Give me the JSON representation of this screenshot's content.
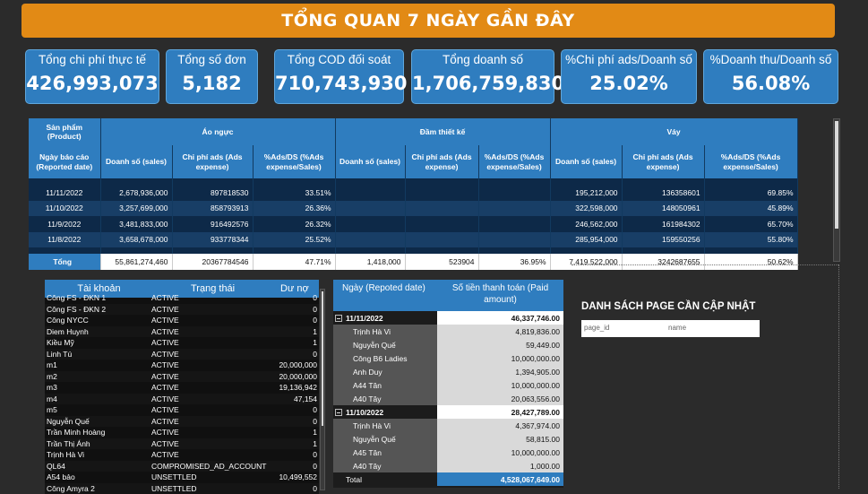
{
  "banner": {
    "title": "TỔNG QUAN 7 NGÀY GẦN ĐÂY"
  },
  "kpis": [
    {
      "label": "Tổng chi phí thực tế",
      "value": "426,993,073"
    },
    {
      "label": "Tổng số đơn",
      "value": "5,182"
    },
    {
      "label": "Tổng COD đối soát",
      "value": "710,743,930"
    },
    {
      "label": "Tổng doanh số",
      "value": "1,706,759,830"
    },
    {
      "label": "%Chi phí ads/Doanh số",
      "value": "25.02%"
    },
    {
      "label": "%Doanh thu/Doanh số",
      "value": "56.08%"
    }
  ],
  "matrix": {
    "product_header": "Sản phẩm (Product)",
    "date_header": "Ngày báo cáo (Reported date)",
    "groups": [
      "Áo ngực",
      "Đầm thiết kế",
      "Váy"
    ],
    "g1_cols": [
      "Doanh số (sales)",
      "Chi phí ads (Ads expense)",
      "%Ads/DS (%Ads expense/Sales)"
    ],
    "g2_cols": [
      "Doanh số (sales)",
      "Chi phí ads (Ads expense)",
      "%Ads/DS (%Ads expense/Sales)"
    ],
    "g3_cols": [
      "Doanh số (sales)",
      "Chi phí ads (Ads expense)",
      "%Ads/DS (%Ads expense/Sales)"
    ],
    "rows": [
      {
        "date": "11/11/2022",
        "g1": [
          "2,678,936,000",
          "897818530",
          "33.51%"
        ],
        "g2": [
          "",
          "",
          ""
        ],
        "g3": [
          "195,212,000",
          "136358601",
          "69.85%"
        ]
      },
      {
        "date": "11/10/2022",
        "g1": [
          "3,257,699,000",
          "858793913",
          "26.36%"
        ],
        "g2": [
          "",
          "",
          ""
        ],
        "g3": [
          "322,598,000",
          "148050961",
          "45.89%"
        ]
      },
      {
        "date": "11/9/2022",
        "g1": [
          "3,481,833,000",
          "916492576",
          "26.32%"
        ],
        "g2": [
          "",
          "",
          ""
        ],
        "g3": [
          "246,562,000",
          "161984302",
          "65.70%"
        ]
      },
      {
        "date": "11/8/2022",
        "g1": [
          "3,658,678,000",
          "933778344",
          "25.52%"
        ],
        "g2": [
          "",
          "",
          ""
        ],
        "g3": [
          "285,954,000",
          "159550256",
          "55.80%"
        ]
      }
    ],
    "total": {
      "label": "Tổng",
      "g1": [
        "55,861,274,460",
        "20367784546",
        "47.71%"
      ],
      "g2": [
        "1,418,000",
        "523904",
        "36.95%"
      ],
      "g3": [
        "7,419,522,000",
        "3242687655",
        "50.62%"
      ]
    }
  },
  "accounts": {
    "headers": {
      "account": "Tài khoản",
      "status": "Trạng thái",
      "debt": "Dư nợ"
    },
    "rows": [
      {
        "account": "Công FS - ĐKN 1",
        "status": "ACTIVE",
        "debt": "0"
      },
      {
        "account": "Công FS - ĐKN 2",
        "status": "ACTIVE",
        "debt": "0"
      },
      {
        "account": "Công NYCC",
        "status": "ACTIVE",
        "debt": "0"
      },
      {
        "account": "Diem Huynh",
        "status": "ACTIVE",
        "debt": "1"
      },
      {
        "account": "Kiều Mỹ",
        "status": "ACTIVE",
        "debt": "1"
      },
      {
        "account": "Linh Tú",
        "status": "ACTIVE",
        "debt": "0"
      },
      {
        "account": "m1",
        "status": "ACTIVE",
        "debt": "20,000,000"
      },
      {
        "account": "m2",
        "status": "ACTIVE",
        "debt": "20,000,000"
      },
      {
        "account": "m3",
        "status": "ACTIVE",
        "debt": "19,136,942"
      },
      {
        "account": "m4",
        "status": "ACTIVE",
        "debt": "47,154"
      },
      {
        "account": "m5",
        "status": "ACTIVE",
        "debt": "0"
      },
      {
        "account": "Nguyễn Quế",
        "status": "ACTIVE",
        "debt": "0"
      },
      {
        "account": "Trần Minh Hoàng",
        "status": "ACTIVE",
        "debt": "1"
      },
      {
        "account": "Trần Thị Ánh",
        "status": "ACTIVE",
        "debt": "1"
      },
      {
        "account": "Trịnh Hà Vi",
        "status": "ACTIVE",
        "debt": "0"
      },
      {
        "account": "QL64",
        "status": "COMPROMISED_AD_ACCOUNT",
        "debt": "0"
      },
      {
        "account": "A54 bảo",
        "status": "UNSETTLED",
        "debt": "10,499,552"
      },
      {
        "account": "Công Amyra 2",
        "status": "UNSETTLED",
        "debt": "0"
      }
    ]
  },
  "payments": {
    "headers": {
      "date": "Ngày (Repoted date)",
      "amount": "Số tiền thanh toán (Paid amount)"
    },
    "rows": [
      {
        "kind": "grp",
        "label": "11/11/2022",
        "value": "46,337,746.00"
      },
      {
        "kind": "item",
        "label": "Trịnh Hà Vi",
        "value": "4,819,836.00"
      },
      {
        "kind": "item",
        "label": "Nguyễn Quế",
        "value": "59,449.00"
      },
      {
        "kind": "item",
        "label": "Công B6 Ladies",
        "value": "10,000,000.00"
      },
      {
        "kind": "item",
        "label": "Anh Duy",
        "value": "1,394,905.00"
      },
      {
        "kind": "item",
        "label": "A44 Tân",
        "value": "10,000,000.00"
      },
      {
        "kind": "item",
        "label": "A40 Tây",
        "value": "20,063,556.00"
      },
      {
        "kind": "grp",
        "label": "11/10/2022",
        "value": "28,427,789.00"
      },
      {
        "kind": "item",
        "label": "Trịnh Hà Vi",
        "value": "4,367,974.00"
      },
      {
        "kind": "item",
        "label": "Nguyễn Quế",
        "value": "58,815.00"
      },
      {
        "kind": "item",
        "label": "A45 Tân",
        "value": "10,000,000.00"
      },
      {
        "kind": "item",
        "label": "A40 Tây",
        "value": "1,000.00"
      },
      {
        "kind": "tot",
        "label": "Total",
        "value": "4,528,067,649.00"
      }
    ]
  },
  "pagelist": {
    "title": "DANH SÁCH PAGE CẦN CẬP NHẬT",
    "col1": "page_id",
    "col2": "name"
  },
  "colors": {
    "banner": "#e28a15",
    "accent": "#2f7dbf",
    "dark_row": "#0d2948",
    "light_row": "#183e66"
  }
}
